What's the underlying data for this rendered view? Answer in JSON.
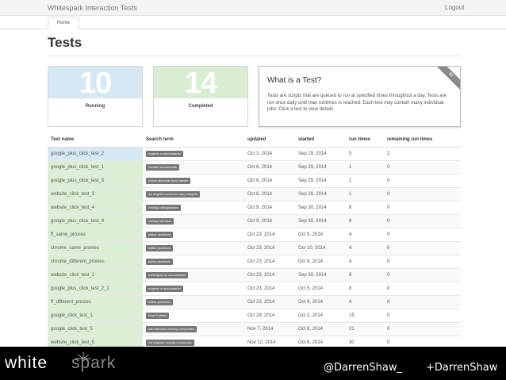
{
  "app": {
    "title": "Whitespark Interaction Tests",
    "logout_label": "Logout"
  },
  "nav": {
    "home_label": "Home"
  },
  "page": {
    "title": "Tests"
  },
  "stats": {
    "running": {
      "value": "10",
      "label": "Running",
      "color": "#d5e8f3"
    },
    "completed": {
      "value": "14",
      "label": "Completed",
      "color": "#d8edd2"
    }
  },
  "info": {
    "title": "What is a Test?",
    "ribbon": "88",
    "body": "Tests are scripts that are queued to run at specified times throughout a day. Tests are run once daily until max runtimes is reached. Each test may contain many individual jobs. Click a test to view details."
  },
  "table": {
    "columns": [
      "Test name",
      "Search term",
      "updated",
      "started",
      "run times",
      "remaining run times"
    ],
    "rows": [
      [
        "google_plus_click_test_2",
        "eugene or accountants",
        "Oct 3, 2014",
        "Sep 29, 2014",
        "5",
        "2"
      ],
      [
        "google_plus_click_test_1",
        "boulder accountants",
        "Oct 6, 2014",
        "Sep 29, 2014",
        "1",
        "0"
      ],
      [
        "google_plus_click_test_3",
        "miami personal injury lawyer",
        "Oct 6, 2014",
        "Sep 29, 2014",
        "1",
        "0"
      ],
      [
        "website_click_test_3",
        "los angeles personal injury lawyers",
        "Oct 6, 2014",
        "Sep 29, 2014",
        "1",
        "0"
      ],
      [
        "website_click_test_4",
        "chicago chiropractors",
        "Oct 9, 2014",
        "Sep 30, 2014",
        "8",
        "0"
      ],
      [
        "google_plus_click_test_4",
        "chicago dentists",
        "Oct 9, 2014",
        "Sep 30, 2014",
        "8",
        "0"
      ],
      [
        "ff_same_proxies",
        "dallas plumbers",
        "Oct 23, 2014",
        "Oct 9, 2014",
        "4",
        "0"
      ],
      [
        "chrome_same_proxies",
        "dallas plumbers",
        "Oct 23, 2014",
        "Oct 10, 2014",
        "4",
        "0"
      ],
      [
        "chrome_different_proxies",
        "dallas plumbers",
        "Oct 23, 2014",
        "Oct 9, 2014",
        "4",
        "0"
      ],
      [
        "website_click_test_2",
        "wilmington nc accountants",
        "Oct 23, 2014",
        "Sep 30, 2014",
        "8",
        "0"
      ],
      [
        "google_plus_click_test_2_1",
        "eugene or accountants",
        "Oct 23, 2014",
        "Oct 5, 2014",
        "8",
        "0"
      ],
      [
        "ff_different_proxies",
        "dallas plumbers",
        "Oct 23, 2014",
        "Oct 9, 2014",
        "4",
        "0"
      ],
      [
        "google_click_test_1",
        "Wow Dublins",
        "Oct 29, 2014",
        "Oct 2, 2014",
        "15",
        "0"
      ],
      [
        "google_click_test_5",
        "san francisco moving companies",
        "Nov 7, 2014",
        "Oct 6, 2014",
        "31",
        "0"
      ],
      [
        "website_click_test_5",
        "los angeles moving companies",
        "Nov 12, 2014",
        "Oct 6, 2014",
        "30",
        "0"
      ]
    ]
  },
  "footer": {
    "logo_white": "white",
    "logo_gray": "spark",
    "twitter": "@DarrenShaw_",
    "gplus": "+DarrenShaw"
  }
}
